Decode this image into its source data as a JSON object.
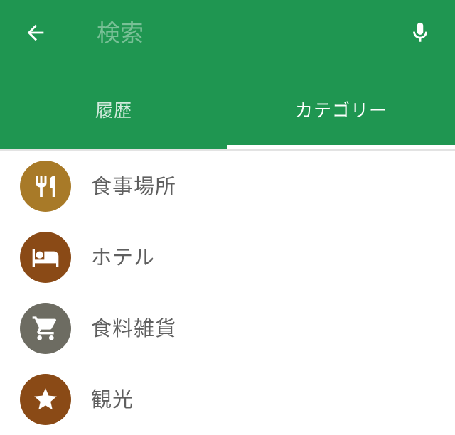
{
  "search": {
    "placeholder": "検索"
  },
  "tabs": [
    {
      "label": "履歴"
    },
    {
      "label": "カテゴリー"
    }
  ],
  "categories": [
    {
      "label": "食事場所",
      "icon": "restaurant-icon",
      "color": "#a87a28"
    },
    {
      "label": "ホテル",
      "icon": "hotel-icon",
      "color": "#8a4a16"
    },
    {
      "label": "食料雑貨",
      "icon": "shopping-cart-icon",
      "color": "#6d6c62"
    },
    {
      "label": "観光",
      "icon": "star-icon",
      "color": "#8a4a16"
    }
  ],
  "colors": {
    "appbar": "#1f9651",
    "label": "#5f5f5f"
  }
}
